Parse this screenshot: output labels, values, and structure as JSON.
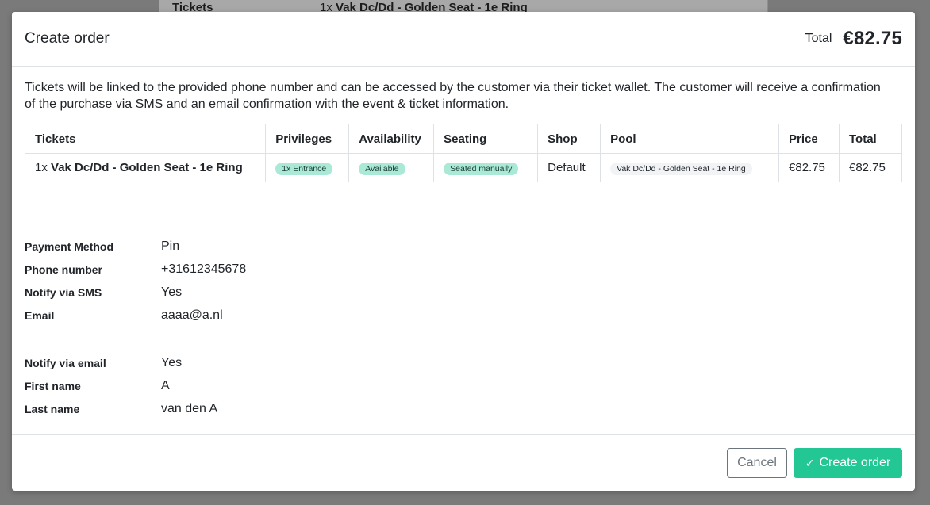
{
  "background": {
    "label": "Tickets",
    "value_qty": "1x",
    "value_name": "Vak Dc/Dd - Golden Seat - 1e Ring"
  },
  "header": {
    "title": "Create order",
    "total_label": "Total",
    "total_amount": "€82.75"
  },
  "intro_text": "Tickets will be linked to the provided phone number and can be accessed by the customer via their ticket wallet. The customer will receive a confirmation of the purchase via SMS and an email confirmation with the event & ticket information.",
  "table": {
    "headers": [
      "Tickets",
      "Privileges",
      "Availability",
      "Seating",
      "Shop",
      "Pool",
      "Price",
      "Total"
    ],
    "rows": [
      {
        "qty": "1x",
        "name": "Vak Dc/Dd - Golden Seat - 1e Ring",
        "privileges": "1x Entrance",
        "availability": "Available",
        "seating": "Seated manually",
        "shop": "Default",
        "pool": "Vak Dc/Dd - Golden Seat - 1e Ring",
        "price": "€82.75",
        "total": "€82.75"
      }
    ]
  },
  "details": {
    "group1": [
      {
        "label": "Payment Method",
        "value": "Pin"
      },
      {
        "label": "Phone number",
        "value": "+31612345678"
      },
      {
        "label": "Notify via SMS",
        "value": "Yes"
      },
      {
        "label": "Email",
        "value": "aaaa@a.nl"
      }
    ],
    "group2": [
      {
        "label": "Notify via email",
        "value": "Yes"
      },
      {
        "label": "First name",
        "value": "A"
      },
      {
        "label": "Last name",
        "value": "van den A"
      }
    ]
  },
  "footer": {
    "cancel_label": "Cancel",
    "create_label": "Create order",
    "create_icon": "check-icon"
  },
  "colors": {
    "accent": "#22c793",
    "pill_bg": "#a9e9d6"
  }
}
